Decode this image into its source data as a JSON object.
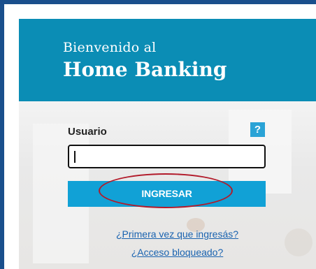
{
  "header": {
    "welcome": "Bienvenido al",
    "brand": "Home Banking"
  },
  "login": {
    "user_label": "Usuario",
    "help_label": "?",
    "user_value": "",
    "submit_label": "INGRESAR"
  },
  "links": {
    "first_time": "¿Primera vez que ingresás?",
    "blocked": "¿Acceso bloqueado?"
  },
  "colors": {
    "header_bg": "#0b8db5",
    "button_bg": "#11a1d6",
    "link": "#1a63b0",
    "annotation": "#b21a2a"
  }
}
